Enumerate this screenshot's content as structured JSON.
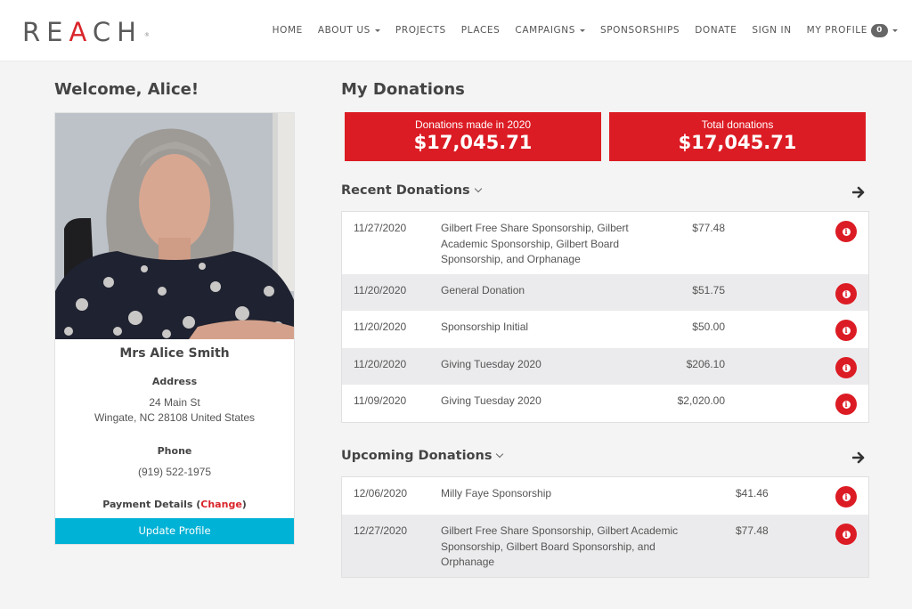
{
  "header": {
    "logo": {
      "pre": "RE",
      "accent": "A",
      "post": "CH",
      "reg": "®"
    },
    "nav": [
      {
        "label": "HOME",
        "dropdown": false
      },
      {
        "label": "ABOUT US",
        "dropdown": true
      },
      {
        "label": "PROJECTS",
        "dropdown": false
      },
      {
        "label": "PLACES",
        "dropdown": false
      },
      {
        "label": "CAMPAIGNS",
        "dropdown": true
      },
      {
        "label": "SPONSORSHIPS",
        "dropdown": false
      },
      {
        "label": "DONATE",
        "dropdown": false
      },
      {
        "label": "SIGN IN",
        "dropdown": false
      },
      {
        "label": "MY PROFILE",
        "dropdown": true,
        "badge": "0"
      }
    ]
  },
  "profile": {
    "welcome": "Welcome, Alice!",
    "name": "Mrs Alice Smith",
    "address_label": "Address",
    "address_line1": "24 Main St",
    "address_line2": "Wingate, NC 28108 United States",
    "phone_label": "Phone",
    "phone": "(919) 522-1975",
    "payment_label": "Payment Details (",
    "payment_change": "Change",
    "payment_close": ")",
    "update_button": "Update Profile"
  },
  "donations": {
    "title": "My Donations",
    "stats": [
      {
        "label": "Donations made in 2020",
        "value": "$17,045.71"
      },
      {
        "label": "Total donations",
        "value": "$17,045.71"
      }
    ],
    "recent": {
      "title": "Recent Donations",
      "rows": [
        {
          "date": "11/27/2020",
          "desc": [
            "Gilbert Free Share Sponsorship, Gilbert",
            "Academic Sponsorship, Gilbert Board",
            "Sponsorship, and Orphanage"
          ],
          "amount": "$77.48"
        },
        {
          "date": "11/20/2020",
          "desc": [
            "General Donation"
          ],
          "amount": "$51.75"
        },
        {
          "date": "11/20/2020",
          "desc": [
            "Sponsorship Initial"
          ],
          "amount": "$50.00"
        },
        {
          "date": "11/20/2020",
          "desc": [
            "Giving Tuesday 2020"
          ],
          "amount": "$206.10"
        },
        {
          "date": "11/09/2020",
          "desc": [
            "Giving Tuesday 2020"
          ],
          "amount": "$2,020.00"
        }
      ]
    },
    "upcoming": {
      "title": "Upcoming Donations",
      "rows": [
        {
          "date": "12/06/2020",
          "desc": [
            "Milly Faye Sponsorship"
          ],
          "amount": "$41.46"
        },
        {
          "date": "12/27/2020",
          "desc": [
            "Gilbert Free Share Sponsorship, Gilbert Academic",
            "Sponsorship, Gilbert Board Sponsorship, and",
            "Orphanage"
          ],
          "amount": "$77.48"
        }
      ]
    }
  },
  "colors": {
    "brand_red": "#dc1c24",
    "button_cyan": "#00b2d6"
  }
}
